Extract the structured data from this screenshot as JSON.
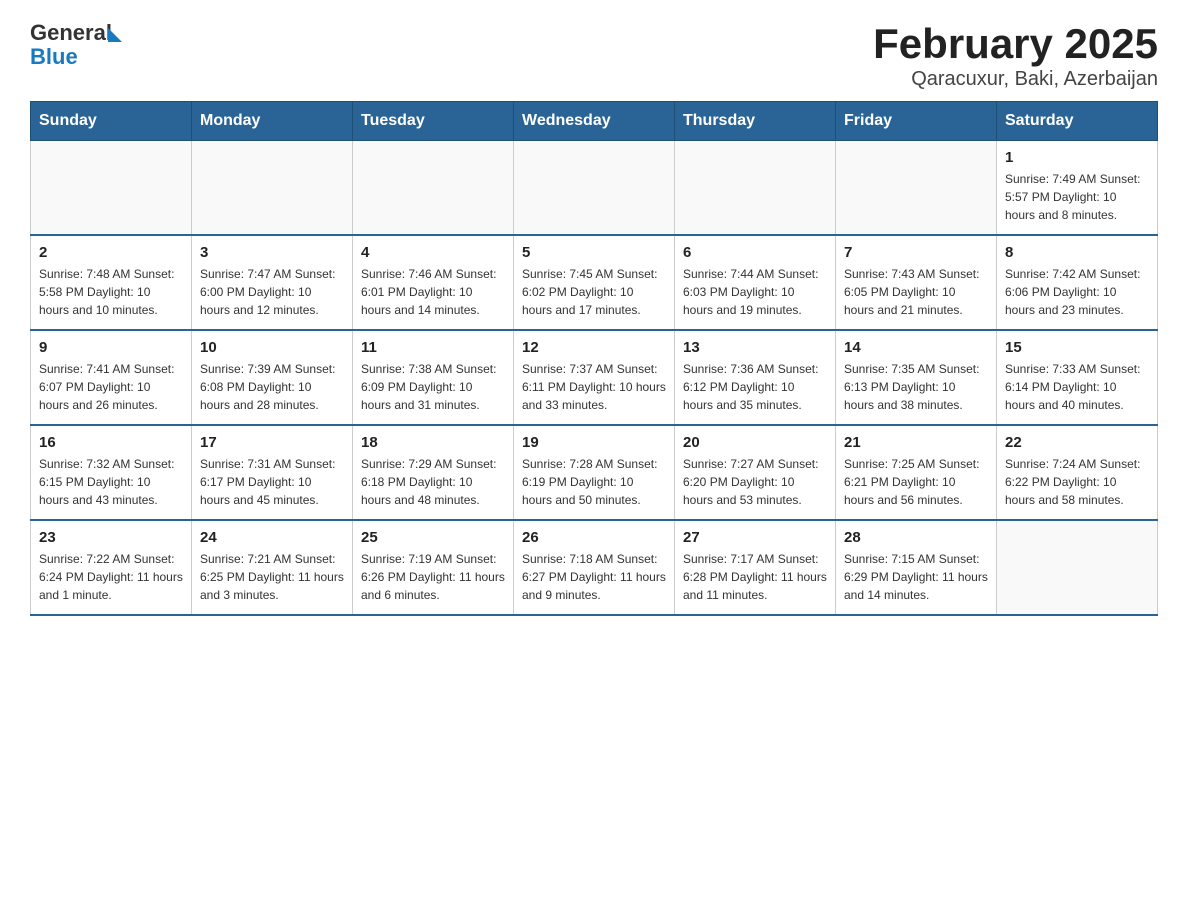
{
  "header": {
    "logo": {
      "general": "General",
      "blue": "Blue"
    },
    "title": "February 2025",
    "subtitle": "Qaracuxur, Baki, Azerbaijan"
  },
  "days_of_week": [
    "Sunday",
    "Monday",
    "Tuesday",
    "Wednesday",
    "Thursday",
    "Friday",
    "Saturday"
  ],
  "weeks": [
    [
      {
        "day": "",
        "info": ""
      },
      {
        "day": "",
        "info": ""
      },
      {
        "day": "",
        "info": ""
      },
      {
        "day": "",
        "info": ""
      },
      {
        "day": "",
        "info": ""
      },
      {
        "day": "",
        "info": ""
      },
      {
        "day": "1",
        "info": "Sunrise: 7:49 AM\nSunset: 5:57 PM\nDaylight: 10 hours and 8 minutes."
      }
    ],
    [
      {
        "day": "2",
        "info": "Sunrise: 7:48 AM\nSunset: 5:58 PM\nDaylight: 10 hours and 10 minutes."
      },
      {
        "day": "3",
        "info": "Sunrise: 7:47 AM\nSunset: 6:00 PM\nDaylight: 10 hours and 12 minutes."
      },
      {
        "day": "4",
        "info": "Sunrise: 7:46 AM\nSunset: 6:01 PM\nDaylight: 10 hours and 14 minutes."
      },
      {
        "day": "5",
        "info": "Sunrise: 7:45 AM\nSunset: 6:02 PM\nDaylight: 10 hours and 17 minutes."
      },
      {
        "day": "6",
        "info": "Sunrise: 7:44 AM\nSunset: 6:03 PM\nDaylight: 10 hours and 19 minutes."
      },
      {
        "day": "7",
        "info": "Sunrise: 7:43 AM\nSunset: 6:05 PM\nDaylight: 10 hours and 21 minutes."
      },
      {
        "day": "8",
        "info": "Sunrise: 7:42 AM\nSunset: 6:06 PM\nDaylight: 10 hours and 23 minutes."
      }
    ],
    [
      {
        "day": "9",
        "info": "Sunrise: 7:41 AM\nSunset: 6:07 PM\nDaylight: 10 hours and 26 minutes."
      },
      {
        "day": "10",
        "info": "Sunrise: 7:39 AM\nSunset: 6:08 PM\nDaylight: 10 hours and 28 minutes."
      },
      {
        "day": "11",
        "info": "Sunrise: 7:38 AM\nSunset: 6:09 PM\nDaylight: 10 hours and 31 minutes."
      },
      {
        "day": "12",
        "info": "Sunrise: 7:37 AM\nSunset: 6:11 PM\nDaylight: 10 hours and 33 minutes."
      },
      {
        "day": "13",
        "info": "Sunrise: 7:36 AM\nSunset: 6:12 PM\nDaylight: 10 hours and 35 minutes."
      },
      {
        "day": "14",
        "info": "Sunrise: 7:35 AM\nSunset: 6:13 PM\nDaylight: 10 hours and 38 minutes."
      },
      {
        "day": "15",
        "info": "Sunrise: 7:33 AM\nSunset: 6:14 PM\nDaylight: 10 hours and 40 minutes."
      }
    ],
    [
      {
        "day": "16",
        "info": "Sunrise: 7:32 AM\nSunset: 6:15 PM\nDaylight: 10 hours and 43 minutes."
      },
      {
        "day": "17",
        "info": "Sunrise: 7:31 AM\nSunset: 6:17 PM\nDaylight: 10 hours and 45 minutes."
      },
      {
        "day": "18",
        "info": "Sunrise: 7:29 AM\nSunset: 6:18 PM\nDaylight: 10 hours and 48 minutes."
      },
      {
        "day": "19",
        "info": "Sunrise: 7:28 AM\nSunset: 6:19 PM\nDaylight: 10 hours and 50 minutes."
      },
      {
        "day": "20",
        "info": "Sunrise: 7:27 AM\nSunset: 6:20 PM\nDaylight: 10 hours and 53 minutes."
      },
      {
        "day": "21",
        "info": "Sunrise: 7:25 AM\nSunset: 6:21 PM\nDaylight: 10 hours and 56 minutes."
      },
      {
        "day": "22",
        "info": "Sunrise: 7:24 AM\nSunset: 6:22 PM\nDaylight: 10 hours and 58 minutes."
      }
    ],
    [
      {
        "day": "23",
        "info": "Sunrise: 7:22 AM\nSunset: 6:24 PM\nDaylight: 11 hours and 1 minute."
      },
      {
        "day": "24",
        "info": "Sunrise: 7:21 AM\nSunset: 6:25 PM\nDaylight: 11 hours and 3 minutes."
      },
      {
        "day": "25",
        "info": "Sunrise: 7:19 AM\nSunset: 6:26 PM\nDaylight: 11 hours and 6 minutes."
      },
      {
        "day": "26",
        "info": "Sunrise: 7:18 AM\nSunset: 6:27 PM\nDaylight: 11 hours and 9 minutes."
      },
      {
        "day": "27",
        "info": "Sunrise: 7:17 AM\nSunset: 6:28 PM\nDaylight: 11 hours and 11 minutes."
      },
      {
        "day": "28",
        "info": "Sunrise: 7:15 AM\nSunset: 6:29 PM\nDaylight: 11 hours and 14 minutes."
      },
      {
        "day": "",
        "info": ""
      }
    ]
  ]
}
